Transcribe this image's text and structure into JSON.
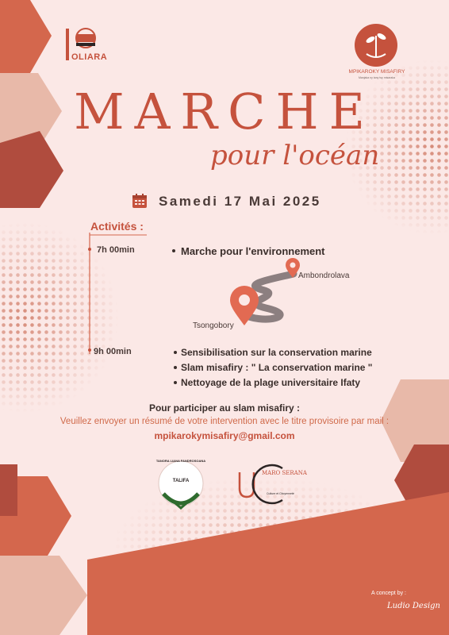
{
  "header": {
    "left_logo_word": "OLIARA",
    "right_logo_name": "MPIKAROKY MISAFIRY",
    "right_logo_tagline": "Manjaka ny tany tsy misaraka"
  },
  "event": {
    "title": "MARCHE",
    "subtitle": "pour l'océan",
    "date": "Samedi 17 Mai 2025"
  },
  "activities": {
    "label": "Activités :",
    "slots": [
      {
        "time": "7h 00min",
        "items": [
          "Marche pour l'environnement"
        ],
        "route": {
          "from": "Tsongobory",
          "to": "Ambondrolava"
        }
      },
      {
        "time": "9h 00min",
        "items": [
          "Sensibilisation sur la conservation marine",
          "Slam misafiry : \" La conservation marine \"",
          "Nettoyage de la plage universitaire Ifaty"
        ]
      }
    ]
  },
  "cta": {
    "heading": "Pour participer au slam misafiry :",
    "text": "Veuillez envoyer un résumé de votre intervention avec le titre provisoire par mail :",
    "email": "mpikarokymisafiry@gmail.com"
  },
  "partners": [
    {
      "arc_text": "TANORA LIANA FANDROSOANA",
      "name": "TALIFA"
    },
    {
      "name": "MARO SERANA",
      "sub": "Culture et Citoyenneté"
    }
  ],
  "footer": {
    "credit": "A concept by :",
    "signature": "Ludio Design"
  },
  "colors": {
    "background": "#fbe8e6",
    "accent": "#c5523d",
    "hexagon_dark": "#b04c3e",
    "hexagon_mid": "#d4674d",
    "hexagon_light": "#e8b9a9",
    "road": "#8c7f80"
  }
}
